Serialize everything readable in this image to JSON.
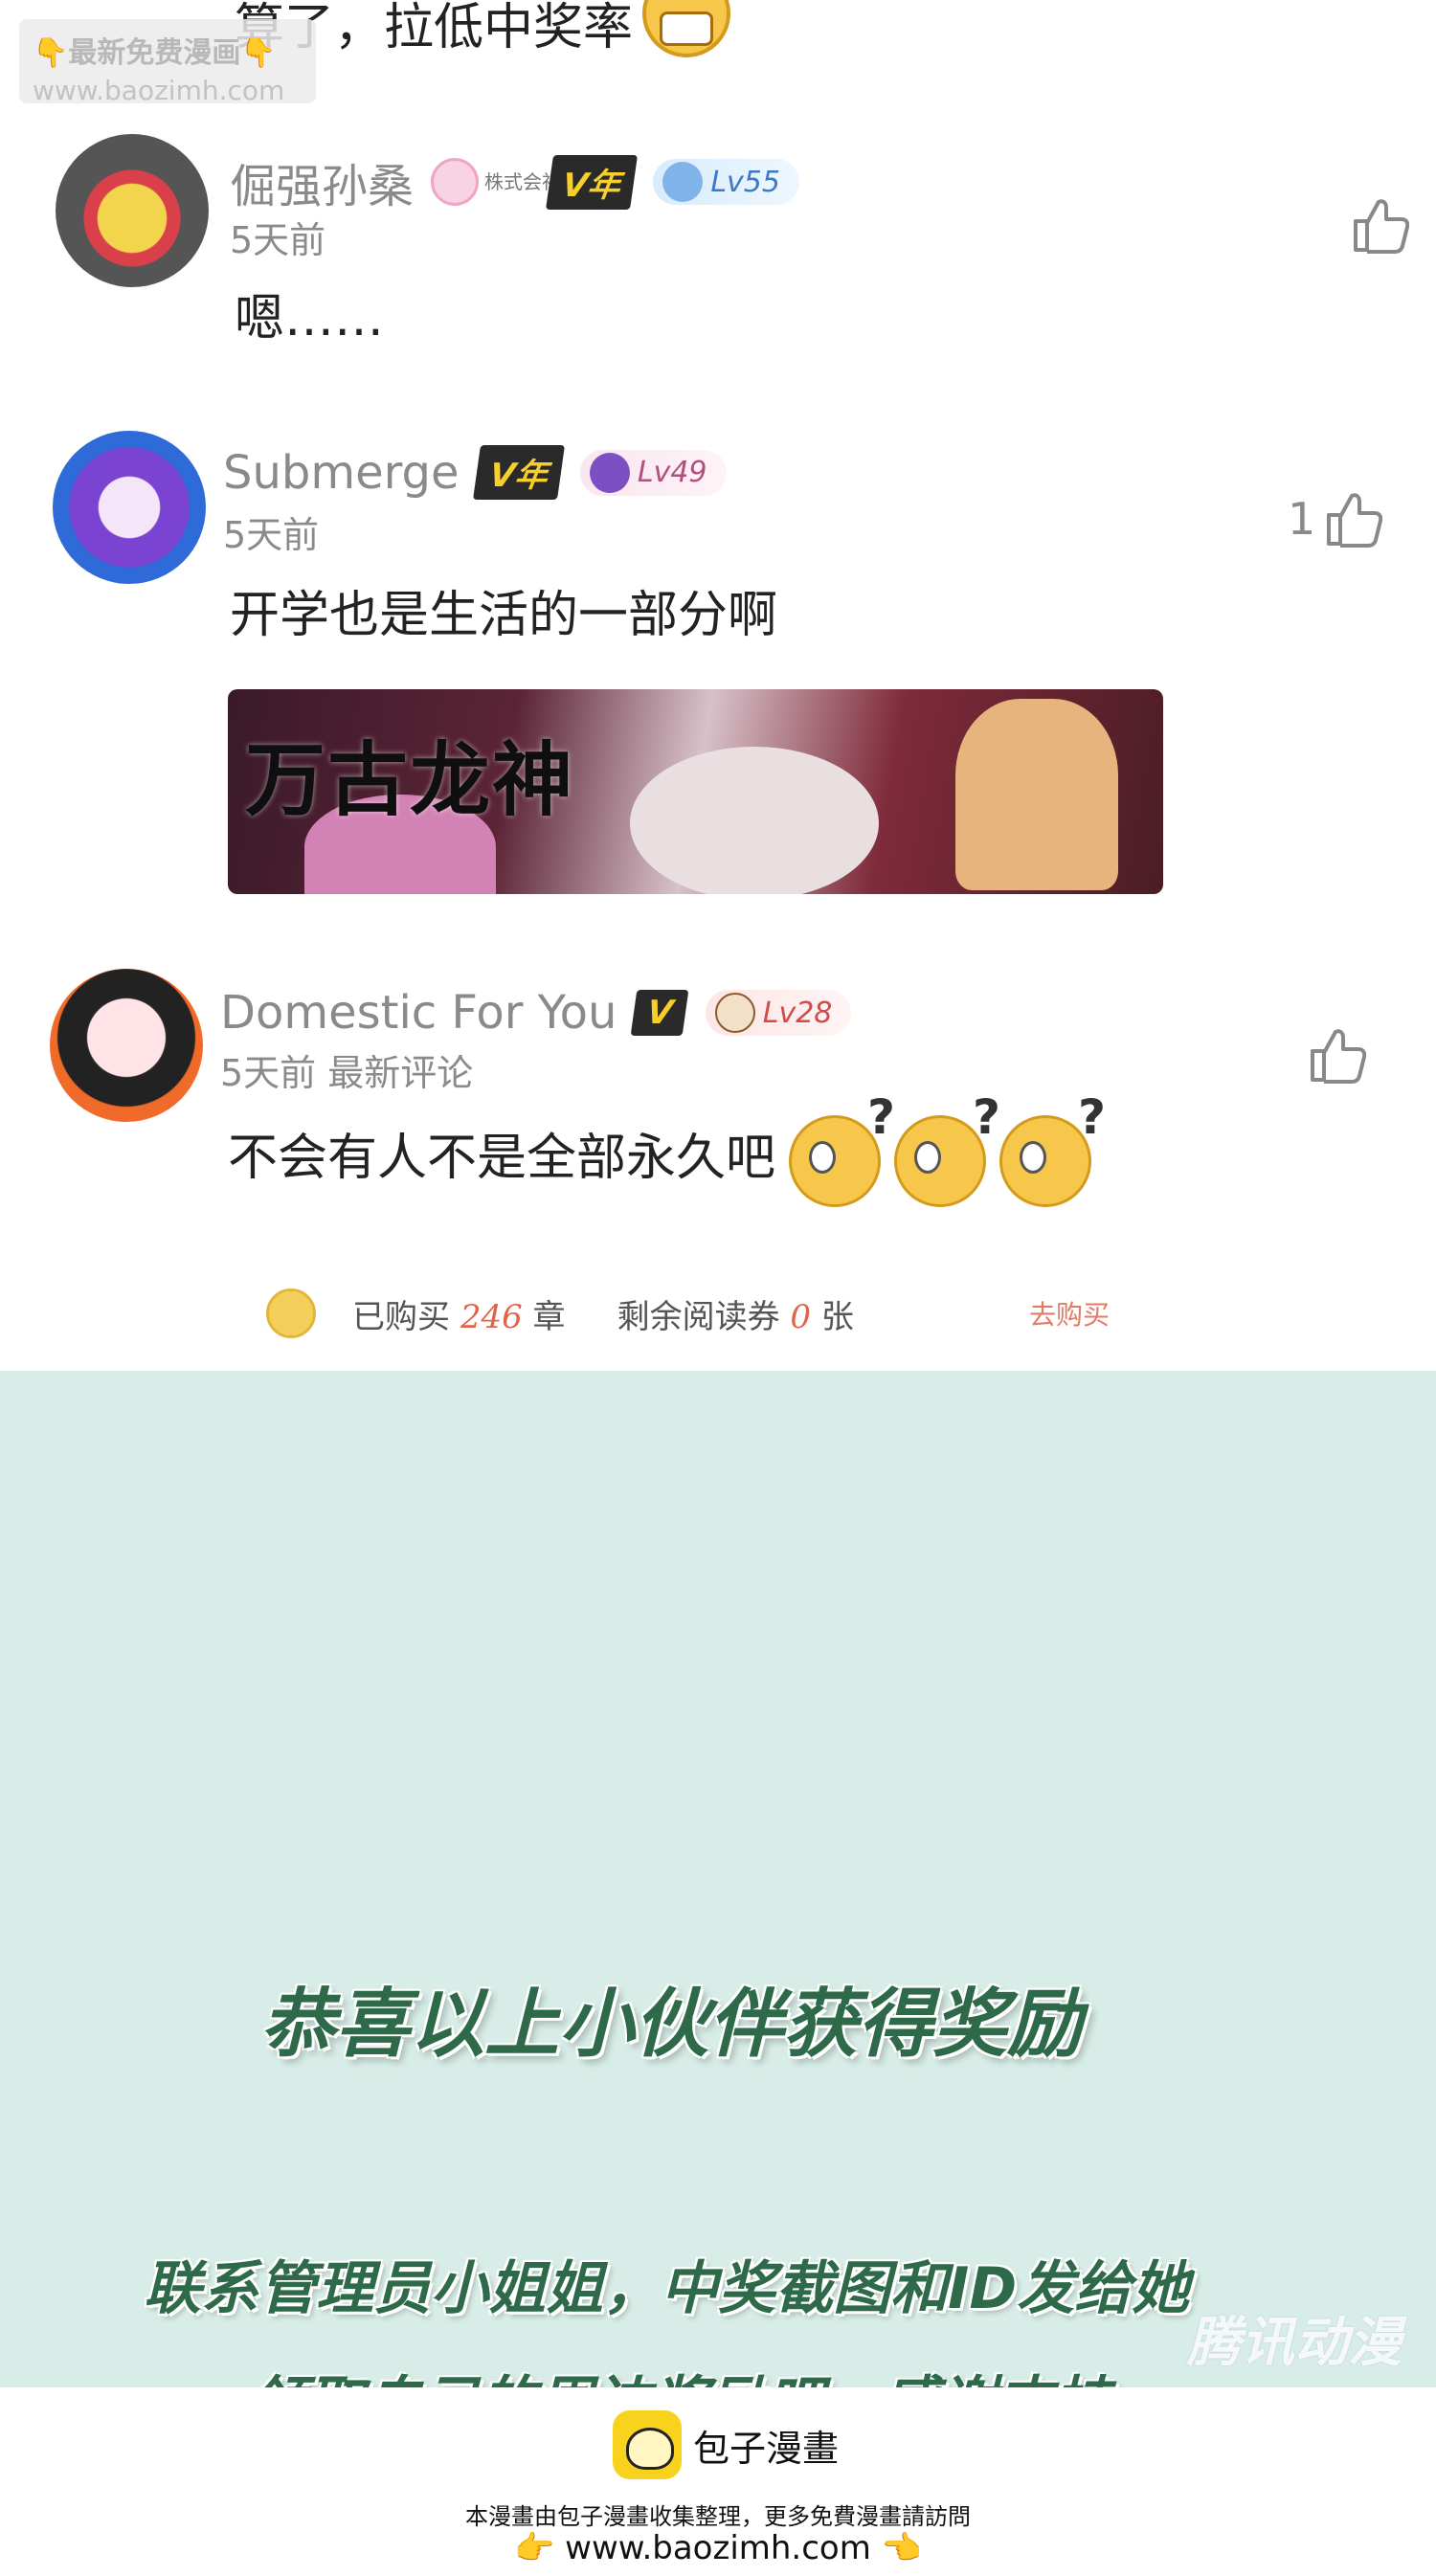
{
  "watermark": {
    "line1": "最新免费漫画",
    "line2": "www.baozimh.com",
    "hand": "👇"
  },
  "previous": {
    "text": "算了，拉低中奖率"
  },
  "comments": [
    {
      "username": "倔强孙桑",
      "corp_badge": "株式会社",
      "vip": "V年",
      "level": "Lv55",
      "time": "5天前",
      "text": "嗯……",
      "likes": ""
    },
    {
      "username": "Submerge",
      "vip": "V年",
      "level": "Lv49",
      "time": "5天前",
      "text": "开学也是生活的一部分啊",
      "likes": "1",
      "image_title": "万古龙神"
    },
    {
      "username": "Domestic For You",
      "vip": "V",
      "level": "Lv28",
      "time": "5天前 最新评论",
      "text": "不会有人不是全部永久吧",
      "likes": ""
    }
  ],
  "buybar": {
    "coin": "购",
    "purchased_label": "已购买",
    "purchased_count": "246",
    "purchased_unit": "章",
    "remaining_label": "剩余阅读券",
    "remaining_count": "0",
    "remaining_unit": "张",
    "go_buy": "去购买"
  },
  "announcement": {
    "congrats": "恭喜以上小伙伴获得奖励",
    "contact": "联系管理员小姐姐，中奖截图和ID发给她",
    "contact2": "领取自己的周边奖励吧，感谢支持～",
    "tencent_watermark": "腾讯动漫"
  },
  "footer": {
    "brand": "包子漫畫",
    "note": "本漫畫由包子漫畫收集整理，更多免費漫畫請訪問",
    "url": "www.baozimh.com",
    "hand_left": "👉",
    "hand_right": "👈"
  },
  "colors": {
    "mint_bg": "#d8ede7",
    "announce_text": "#2e6a4a",
    "vip_gold": "#f7cf2a",
    "level_pink": "#e2624a"
  }
}
